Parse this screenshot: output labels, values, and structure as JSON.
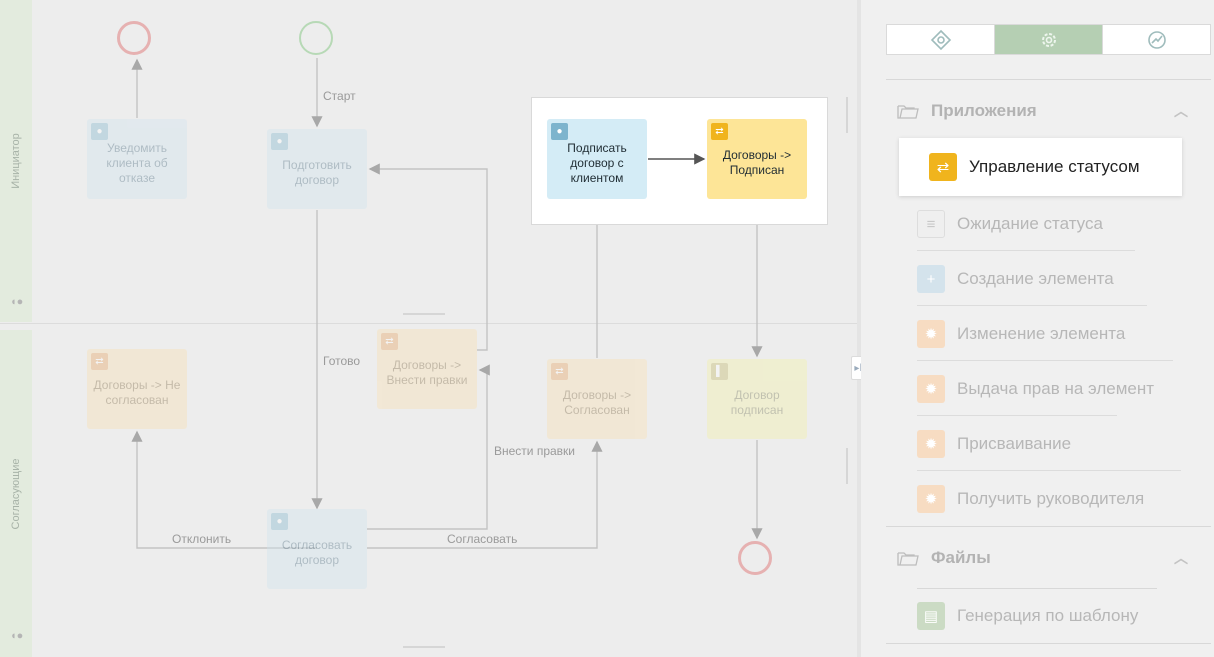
{
  "canvas": {
    "lanes": [
      {
        "label": "Инициатор"
      },
      {
        "label": "Согласующие"
      }
    ],
    "nodes": {
      "notify_reject": {
        "label": "Уведомить клиента об отказе",
        "icon": "user-icon"
      },
      "prepare_contract": {
        "label": "Подготовить договор",
        "icon": "user-icon"
      },
      "sign_with_client": {
        "label": "Подписать договор с клиентом",
        "icon": "user-icon"
      },
      "contracts_signed": {
        "label": "Договоры -> Подписан",
        "icon": "status-swap-icon"
      },
      "contracts_not_agreed": {
        "label": "Договоры -> Не согласован",
        "icon": "status-swap-icon"
      },
      "contracts_edits": {
        "label": "Договоры -> Внести правки",
        "icon": "status-swap-icon"
      },
      "contracts_agreed": {
        "label": "Договоры -> Согласован",
        "icon": "status-swap-icon"
      },
      "contract_signed_end": {
        "label": "Договор подписан",
        "icon": "flag-icon"
      },
      "agree_contract": {
        "label": "Согласовать договор",
        "icon": "user-icon"
      }
    },
    "edge_labels": {
      "start": "Старт",
      "done": "Готово",
      "reject": "Отклонить",
      "agree": "Согласовать",
      "edits": "Внести правки"
    },
    "colors": {
      "start_circle": "#5fb85c",
      "end_circle": "#d94f4f",
      "user_task": "#d4ecf6",
      "status_task": "#fde597",
      "status_icon": "#f0b41d"
    }
  },
  "panel": {
    "tabs": [
      {
        "icon": "diamond-gear-icon"
      },
      {
        "icon": "gear-icon",
        "active": true
      },
      {
        "icon": "clock-chart-icon"
      }
    ],
    "sections": [
      {
        "title": "Приложения",
        "items": [
          {
            "label": "Управление статусом",
            "icon": "status-swap-icon",
            "active": true
          },
          {
            "label": "Ожидание статуса",
            "icon": "wait-icon"
          },
          {
            "label": "Создание элемента",
            "icon": "plus-icon"
          },
          {
            "label": "Изменение элемента",
            "icon": "gear-icon"
          },
          {
            "label": "Выдача прав на элемент",
            "icon": "gear-icon"
          },
          {
            "label": "Присваивание",
            "icon": "gear-icon"
          },
          {
            "label": "Получить руководителя",
            "icon": "gear-icon"
          }
        ]
      },
      {
        "title": "Файлы",
        "items": [
          {
            "label": "Генерация по шаблону",
            "icon": "document-template-icon"
          }
        ]
      }
    ]
  }
}
